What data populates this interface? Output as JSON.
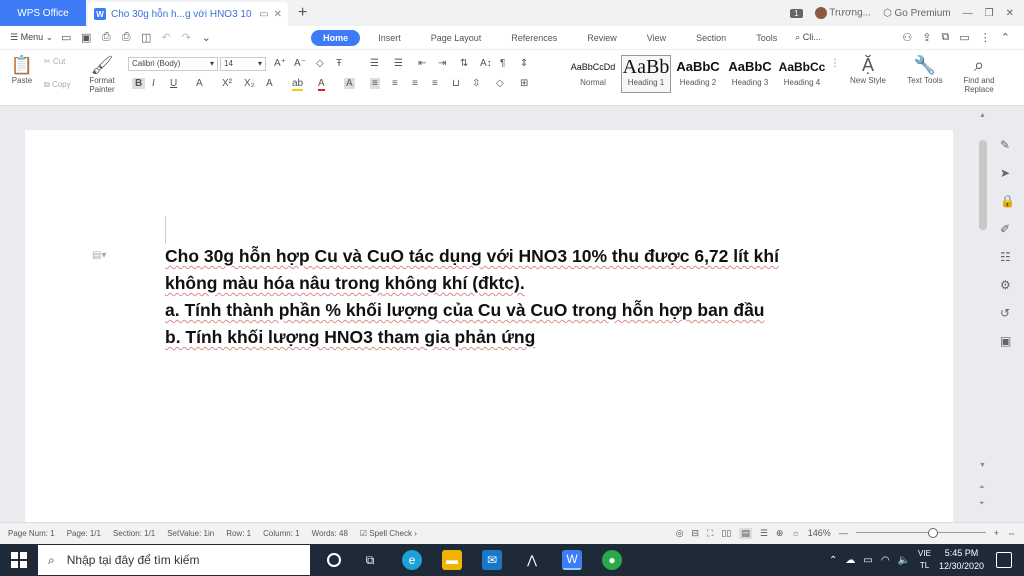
{
  "titlebar": {
    "app_tab": "WPS Office",
    "doc_tab": "Cho 30g hỗn h...g với HNO3 10",
    "badge": "1",
    "user": "Trương...",
    "premium": "Go Premium"
  },
  "menu": {
    "menu_label": "Menu",
    "tabs": [
      "Home",
      "Insert",
      "Page Layout",
      "References",
      "Review",
      "View",
      "Section",
      "Tools"
    ],
    "search_placeholder": "Cli..."
  },
  "ribbon": {
    "paste": "Paste",
    "cut": "Cut",
    "copy": "Copy",
    "format_painter_1": "Format",
    "format_painter_2": "Painter",
    "font_name": "Calibri (Body)",
    "font_size": "14",
    "styles": [
      {
        "preview": "AaBbCcDd",
        "label": "Normal"
      },
      {
        "preview": "AaBb",
        "label": "Heading 1"
      },
      {
        "preview": "AaBbC",
        "label": "Heading 2"
      },
      {
        "preview": "AaBbC",
        "label": "Heading 3"
      },
      {
        "preview": "AaBbCc",
        "label": "Heading 4"
      }
    ],
    "new_style": "New Style",
    "text_tools": "Text Tools",
    "find_replace_1": "Find and",
    "find_replace_2": "Replace"
  },
  "document": {
    "para1": "Cho 30g hỗn hợp Cu và CuO tác dụng với HNO3 10% thu được 6,72 lít khí không màu hóa nâu trong không khí (đktc).",
    "para2": "a.  Tính thành phần % khối lượng của Cu và CuO trong hỗn hợp ban đầu",
    "para3": "b.  Tính khối lượng HNO3 tham gia phản ứng"
  },
  "statusbar": {
    "page_num": "Page Num: 1",
    "page": "Page: 1/1",
    "section": "Section: 1/1",
    "setvalue": "SetValue: 1in",
    "row": "Row: 1",
    "column": "Column: 1",
    "words": "Words: 48",
    "spell_check": "Spell Check",
    "zoom": "146%"
  },
  "taskbar": {
    "search_placeholder": "Nhập tại đây để tìm kiếm",
    "lang_1": "VIE",
    "lang_2": "TL",
    "time": "5:45 PM",
    "date": "12/30/2020"
  },
  "colors": {
    "accent": "#3d7cf6",
    "taskbar": "#1e2a38",
    "page": "#ffffff"
  }
}
